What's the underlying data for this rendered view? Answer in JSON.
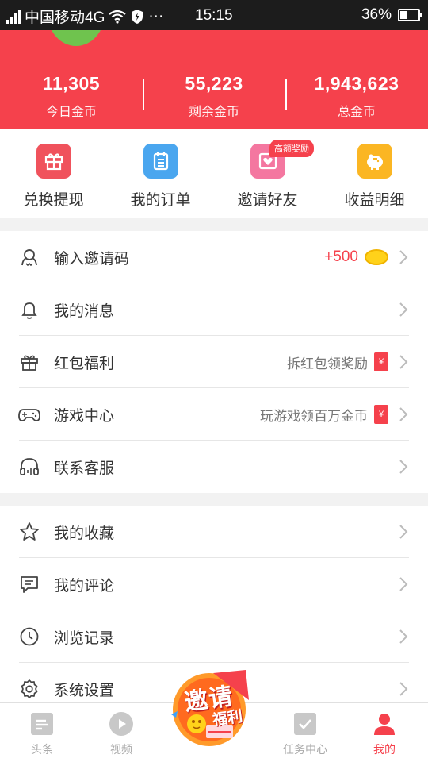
{
  "status_bar": {
    "carrier": "中国移动4G",
    "time": "15:15",
    "battery": "36%",
    "more": "···"
  },
  "stats": [
    {
      "value": "11,305",
      "label": "今日金币"
    },
    {
      "value": "55,223",
      "label": "剩余金币"
    },
    {
      "value": "1,943,623",
      "label": "总金币"
    }
  ],
  "quick_actions": [
    {
      "label": "兑换提现",
      "icon": "gift-box-icon",
      "color": "#f0525c"
    },
    {
      "label": "我的订单",
      "icon": "clipboard-icon",
      "color": "#4aa6ef"
    },
    {
      "label": "邀请好友",
      "icon": "heart-envelope-icon",
      "color": "#f477a0",
      "badge": "高额奖励"
    },
    {
      "label": "收益明细",
      "icon": "piggy-bank-icon",
      "color": "#fbb623"
    }
  ],
  "menu_group1": [
    {
      "label": "输入邀请码",
      "icon": "invite-code-icon",
      "extra": "+500"
    },
    {
      "label": "我的消息",
      "icon": "bell-icon",
      "extra": ""
    },
    {
      "label": "红包福利",
      "icon": "gift-icon",
      "extra": "拆红包领奖励"
    },
    {
      "label": "游戏中心",
      "icon": "gamepad-icon",
      "extra": "玩游戏领百万金币"
    },
    {
      "label": "联系客服",
      "icon": "headset-icon",
      "extra": ""
    }
  ],
  "menu_group2": [
    {
      "label": "我的收藏",
      "icon": "star-icon"
    },
    {
      "label": "我的评论",
      "icon": "comment-icon"
    },
    {
      "label": "浏览记录",
      "icon": "clock-icon"
    },
    {
      "label": "系统设置",
      "icon": "gear-icon"
    }
  ],
  "red_packet_glyph": "¥",
  "promo": {
    "line1": "邀请",
    "line2": "福利"
  },
  "tabs": [
    {
      "label": "头条",
      "icon": "news-icon"
    },
    {
      "label": "视频",
      "icon": "play-icon"
    },
    {
      "label": "任务中心",
      "icon": "checkbox-icon"
    },
    {
      "label": "我的",
      "icon": "person-icon",
      "active": true
    }
  ],
  "colors": {
    "brand_red": "#f5414c",
    "inactive_gray": "#aaaaaa"
  }
}
